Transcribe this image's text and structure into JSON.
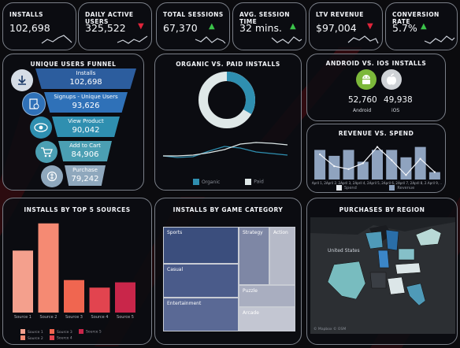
{
  "kpis": [
    {
      "title": "INSTALLS",
      "value": "102,698",
      "trend": "up"
    },
    {
      "title": "DAILY ACTIVE USERS",
      "value": "325,522",
      "trend": "down"
    },
    {
      "title": "TOTAL SESSIONS",
      "value": "67,370",
      "trend": "up"
    },
    {
      "title": "AVG. SESSION TIME",
      "value": "32 mins.",
      "trend": "up"
    },
    {
      "title": "LTV REVENUE",
      "value": "$97,004",
      "trend": "down"
    },
    {
      "title": "CONVERSION RATE",
      "value": "5.7%",
      "trend": "up"
    }
  ],
  "funnel": {
    "title": "UNIQUE USERS FUNNEL",
    "stages": [
      {
        "label": "Installs",
        "value": "102,698",
        "icon": "download-icon",
        "color": "#2c5d9e"
      },
      {
        "label": "Signups - Unique Users",
        "value": "93,626",
        "icon": "signup-icon",
        "color": "#2f71b8"
      },
      {
        "label": "View Product",
        "value": "90,042",
        "icon": "eye-icon",
        "color": "#2f8fb0"
      },
      {
        "label": "Add to Cart",
        "value": "84,906",
        "icon": "cart-icon",
        "color": "#4b9fb3"
      },
      {
        "label": "Purchase",
        "value": "79,242",
        "icon": "purchase-icon",
        "color": "#8fa8bd"
      }
    ]
  },
  "organic_paid": {
    "title": "ORGANIC VS. PAID INSTALLS",
    "legend": [
      "Organic",
      "Paid"
    ],
    "colors": {
      "organic": "#2f8fb0",
      "paid": "#dfe8e8"
    }
  },
  "android_ios": {
    "title": "ANDROID VS. IOS INSTALLS",
    "android_value": "52,760",
    "android_label": "Android",
    "ios_value": "49,938",
    "ios_label": "iOS"
  },
  "revenue_spend": {
    "title": "REVENUE VS. SPEND",
    "categories": [
      "April 1, 2..",
      "April 2, 2..",
      "April 3, 2..",
      "April 4, 2..",
      "April 5, 2..",
      "April 6, 2..",
      "April 7, 2..",
      "April 8, 2..",
      "April 9, .."
    ],
    "legend": [
      "Spend",
      "Revenue"
    ]
  },
  "sources": {
    "title": "INSTALLS BY TOP 5 SOURCES",
    "labels": [
      "Source 1",
      "Source 2",
      "Source 3",
      "Source 4",
      "Source 5"
    ],
    "colors": [
      "#f4a08d",
      "#f58a73",
      "#f06650",
      "#e2444f",
      "#c9264a"
    ]
  },
  "category": {
    "title": "INSTALLS BY GAME CATEGORY",
    "cells": [
      "Sports",
      "Strategy",
      "Action",
      "Casual",
      "Puzzle",
      "Entertainment",
      "Arcade"
    ]
  },
  "region": {
    "title": "PURCHASES BY REGION",
    "country_label": "United States",
    "attribution": "© Mapbox © OSM"
  },
  "chart_data": [
    {
      "type": "bar",
      "title": "INSTALLS BY TOP 5 SOURCES",
      "categories": [
        "Source 1",
        "Source 2",
        "Source 3",
        "Source 4",
        "Source 5"
      ],
      "values": [
        82,
        118,
        43,
        33,
        40
      ],
      "ylim": [
        0,
        125
      ]
    },
    {
      "type": "bar",
      "title": "REVENUE VS. SPEND",
      "categories": [
        "April 1, 2..",
        "April 2, 2..",
        "April 3, 2..",
        "April 4, 2..",
        "April 5, 2..",
        "April 6, 2..",
        "April 7, 2..",
        "April 8, 2..",
        "April 9, .."
      ],
      "series": [
        {
          "name": "Revenue",
          "type": "bar",
          "values": [
            40,
            32,
            40,
            24,
            40,
            40,
            30,
            44,
            10
          ]
        },
        {
          "name": "Spend",
          "type": "line",
          "values": [
            34,
            18,
            14,
            22,
            44,
            26,
            6,
            28,
            10
          ]
        }
      ],
      "ylim": [
        0,
        50
      ]
    }
  ]
}
